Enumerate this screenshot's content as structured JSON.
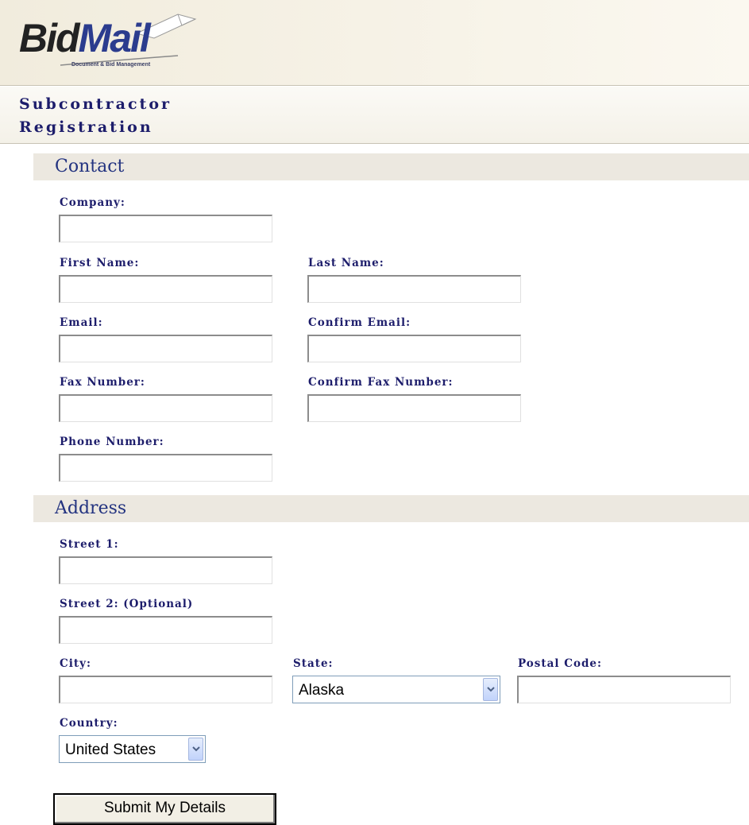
{
  "brand": {
    "logo_bid": "Bid",
    "logo_mail": "Mail",
    "tagline": "Document & Bid Management"
  },
  "page": {
    "title": "Subcontractor Registration"
  },
  "contact": {
    "section_title": "Contact",
    "company_label": "Company:",
    "company_value": "",
    "first_name_label": "First Name:",
    "first_name_value": "",
    "last_name_label": "Last Name:",
    "last_name_value": "",
    "email_label": "Email:",
    "email_value": "",
    "confirm_email_label": "Confirm Email:",
    "confirm_email_value": "",
    "fax_label": "Fax Number:",
    "fax_value": "",
    "confirm_fax_label": "Confirm Fax Number:",
    "confirm_fax_value": "",
    "phone_label": "Phone Number:",
    "phone_value": ""
  },
  "address": {
    "section_title": "Address",
    "street1_label": "Street 1:",
    "street1_value": "",
    "street2_label": "Street 2: (Optional)",
    "street2_value": "",
    "city_label": "City:",
    "city_value": "",
    "state_label": "State:",
    "state_selected": "Alaska",
    "postal_label": "Postal Code:",
    "postal_value": "",
    "country_label": "Country:",
    "country_selected": "United States"
  },
  "actions": {
    "submit_label": "Submit My Details"
  },
  "colors": {
    "label_text": "#1d1d6b",
    "section_bar": "#ece8e0",
    "header_bg": "#f1ecdd",
    "select_border": "#7f9db9"
  }
}
